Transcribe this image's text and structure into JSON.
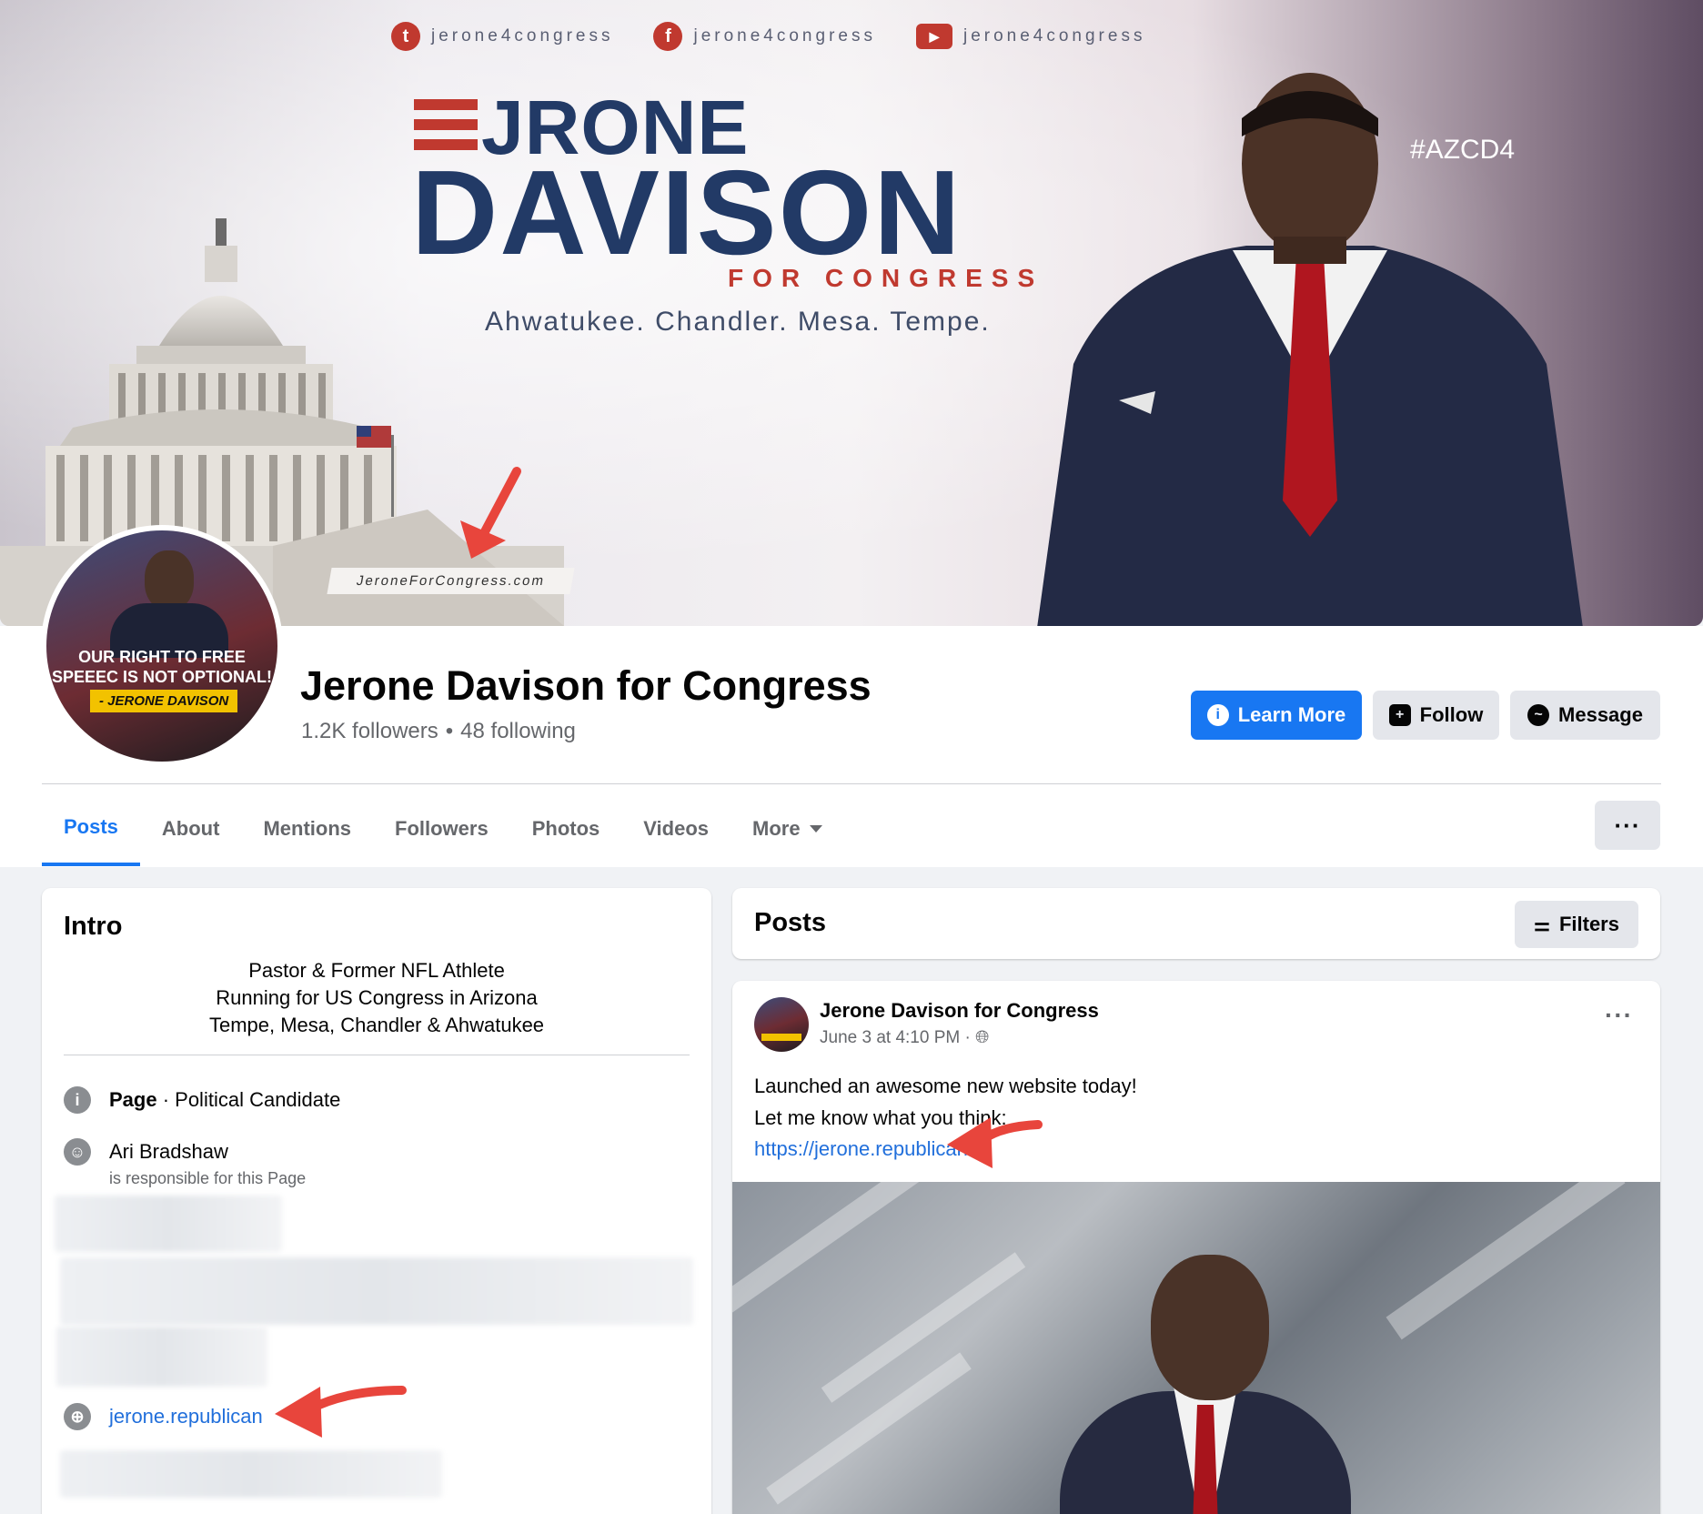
{
  "cover": {
    "socials": [
      {
        "icon": "twitter-icon",
        "glyph": "t",
        "handle": "jerone4congress"
      },
      {
        "icon": "facebook-icon",
        "glyph": "f",
        "handle": "jerone4congress"
      },
      {
        "icon": "youtube-icon",
        "glyph": "▶",
        "handle": "jerone4congress"
      }
    ],
    "first_name": "RONE",
    "last_name": "DAVISON",
    "for_congress": "FOR CONGRESS",
    "cities": "Ahwatukee. Chandler. Mesa. Tempe.",
    "hashtag": "#AZCD4",
    "website": "JeroneForCongress.com"
  },
  "profile": {
    "avatar_quote": "OUR RIGHT TO FREE SPEEEC IS NOT OPTIONAL!",
    "avatar_signature": "- JERONE DAVISON",
    "name": "Jerone Davison for Congress",
    "followers": "1.2K followers",
    "separator": "•",
    "following": "48 following"
  },
  "actions": {
    "learn_more": "Learn More",
    "follow": "Follow",
    "message": "Message"
  },
  "tabs": {
    "posts": "Posts",
    "about": "About",
    "mentions": "Mentions",
    "followers": "Followers",
    "photos": "Photos",
    "videos": "Videos",
    "more": "More",
    "overflow": "···"
  },
  "intro": {
    "title": "Intro",
    "bio_line1": "Pastor & Former NFL Athlete",
    "bio_line2": "Running for US Congress in Arizona",
    "bio_line3": "Tempe, Mesa, Chandler & Ahwatukee",
    "category_bold": "Page",
    "category": " · Political Candidate",
    "manager_name": "Ari Bradshaw",
    "manager_sub": "is responsible for this Page",
    "website": "jerone.republican"
  },
  "posts": {
    "title": "Posts",
    "filters": "Filters",
    "author": "Jerone Davison for Congress",
    "time": "June 3 at 4:10 PM ·",
    "line1": "Launched an awesome new website today!",
    "line2": "Let me know what you think:",
    "link": "https://jerone.republican",
    "more": "···"
  },
  "colors": {
    "accent": "#1877f2",
    "link": "#216fdb",
    "annotation_arrow": "#e8453c",
    "navy": "#223a66",
    "campaign_red": "#c0392f"
  }
}
